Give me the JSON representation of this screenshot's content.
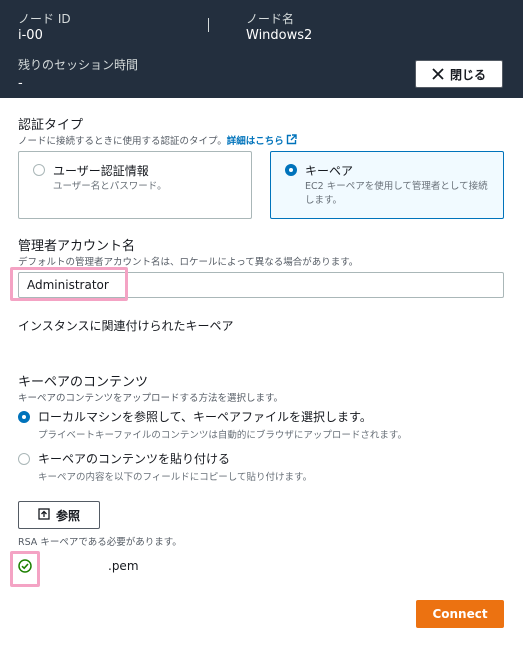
{
  "header": {
    "node_id_label": "ノード ID",
    "node_id_value": "i-00",
    "node_name_label": "ノード名",
    "node_name_value": "Windows2",
    "session_time_label": "残りのセッション時間",
    "session_time_value": "-",
    "close_label": "閉じる"
  },
  "auth_type": {
    "title": "認証タイプ",
    "description": "ノードに接続するときに使用する認証のタイプ。",
    "learn_more": "詳細はこちら",
    "options": [
      {
        "title": "ユーザー認証情報",
        "description": "ユーザー名とパスワード。",
        "selected": false
      },
      {
        "title": "キーペア",
        "description_line1": "EC2 キーペアを使用して管理者として接続",
        "description_line2": "します。",
        "selected": true
      }
    ]
  },
  "admin_account": {
    "title": "管理者アカウント名",
    "description": "デフォルトの管理者アカウント名は、ロケールによって異なる場合があります。",
    "value": "Administrator"
  },
  "associated_key_label": "インスタンスに関連付けられたキーペア",
  "key_content": {
    "title": "キーペアのコンテンツ",
    "description": "キーペアのコンテンツをアップロードする方法を選択します。",
    "options": [
      {
        "title": "ローカルマシンを参照して、キーペアファイルを選択します。",
        "description": "プライベートキーファイルのコンテンツは自動的にブラウザにアップロードされます。",
        "selected": true
      },
      {
        "title": "キーペアのコンテンツを貼り付ける",
        "description": "キーペアの内容を以下のフィールドにコピーして貼り付けます。",
        "selected": false
      }
    ],
    "browse_label": "参照",
    "hint": "RSA キーペアである必要があります。",
    "file_name": ".pem"
  },
  "connect_label": "Connect",
  "colors": {
    "header_bg": "#232f3e",
    "accent": "#0073bb",
    "connect": "#ec7211",
    "highlight": "#f4a3c4",
    "success": "#1d8102"
  }
}
